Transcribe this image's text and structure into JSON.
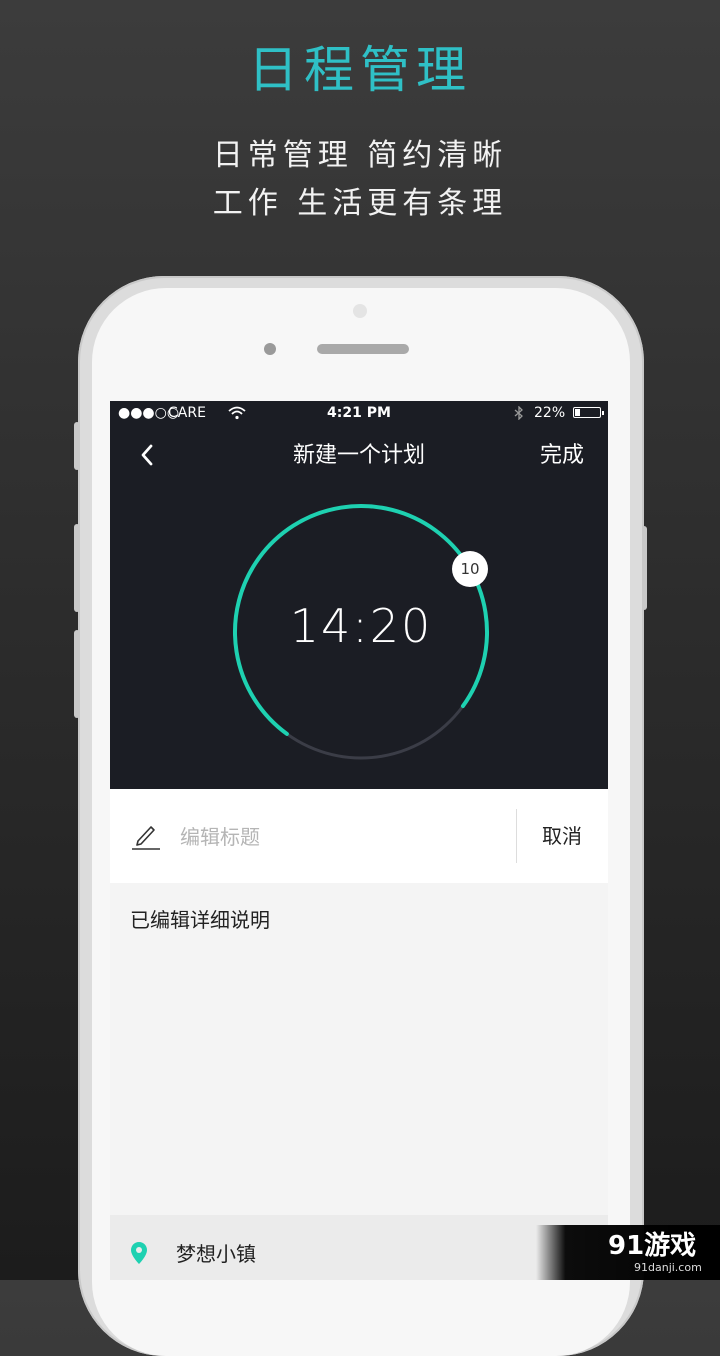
{
  "promo": {
    "headline": "日程管理",
    "subline1": "日常管理 简约清晰",
    "subline2": "工作 生活更有条理"
  },
  "status_bar": {
    "signal": "●●●○○",
    "carrier": "CARE",
    "time": "4:21 PM",
    "battery": "22%",
    "battery_level": 0.22
  },
  "nav": {
    "title": "新建一个计划",
    "done": "完成"
  },
  "timer": {
    "time": "14:20",
    "knob_value": "10",
    "progress": 0.75
  },
  "form": {
    "title_placeholder": "编辑标题",
    "cancel": "取消",
    "description": "已编辑详细说明",
    "location": "梦想小镇"
  },
  "colors": {
    "accent": "#1ed1b1",
    "headline": "#2fc0c6",
    "screen_dark": "#1b1d24"
  },
  "watermark": {
    "logo": "91游戏",
    "url": "91danji.com"
  }
}
